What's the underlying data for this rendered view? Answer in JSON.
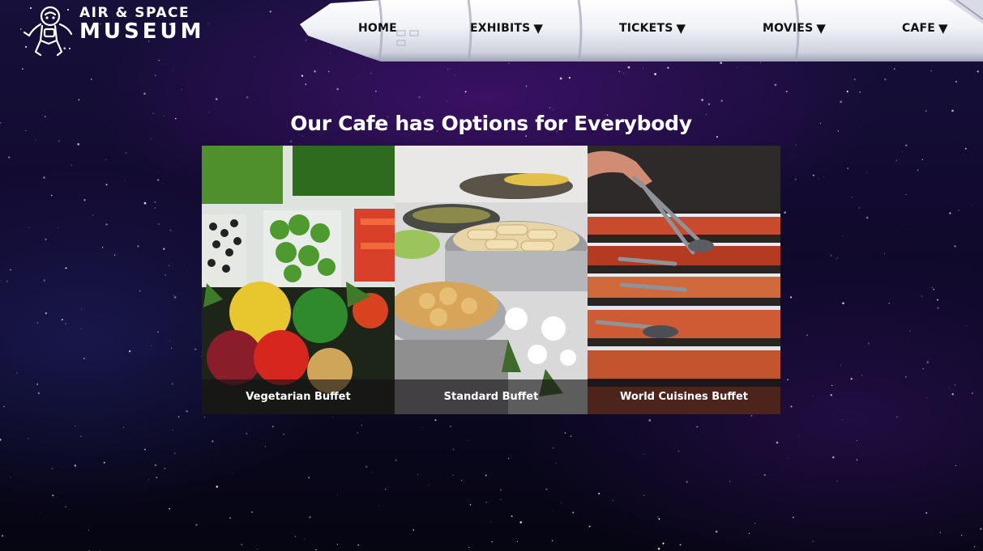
{
  "brand": {
    "line1": "AIR & SPACE",
    "line2": "MUSEUM"
  },
  "nav": {
    "items": [
      {
        "label": "HOME",
        "has_dropdown": false
      },
      {
        "label": "EXHIBITS",
        "has_dropdown": true
      },
      {
        "label": "TICKETS",
        "has_dropdown": true
      },
      {
        "label": "MOVIES",
        "has_dropdown": true
      },
      {
        "label": "CAFE",
        "has_dropdown": true
      }
    ],
    "dropdown_glyph": "▼"
  },
  "main": {
    "headline": "Our Cafe has Options for Everybody",
    "cards": [
      {
        "caption": "Vegetarian Buffet",
        "icon": "vegetable-platter-photo"
      },
      {
        "caption": "Standard Buffet",
        "icon": "chafing-dish-photo"
      },
      {
        "caption": "World Cuisines Buffet",
        "icon": "serving-tongs-photo"
      }
    ]
  },
  "colors": {
    "background": "#120a30",
    "nav_text": "#111111",
    "rocket_body": "#eef0f6",
    "caption_bar": "#141014"
  }
}
